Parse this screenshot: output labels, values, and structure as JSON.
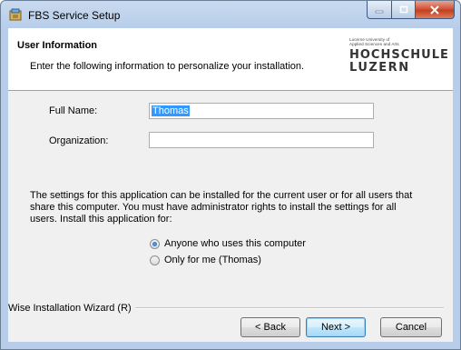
{
  "window": {
    "title": "FBS Service Setup",
    "icon": "installer-icon"
  },
  "caption_buttons": {
    "minimize": "–",
    "maximize": "□",
    "close": "✕"
  },
  "header": {
    "title": "User Information",
    "subtitle": "Enter the following information to personalize your installation.",
    "logo": {
      "small_line1": "Lucerne University of",
      "small_line2": "Applied Sciences and Arts",
      "line1": "HOCHSCHULE",
      "line2": "LUZERN"
    }
  },
  "form": {
    "full_name_label": "Full Name:",
    "full_name_value": "Thomas",
    "organization_label": "Organization:",
    "organization_value": ""
  },
  "info_text": "The settings for this application can be installed for the current user or for all users that share this computer. You must have administrator rights to install the settings for all users. Install this application for:",
  "install_for": {
    "options": [
      "Anyone who uses this computer",
      "Only for me (Thomas)"
    ],
    "selected": "Anyone who uses this computer"
  },
  "footer": {
    "brand": "Wise Installation Wizard (R)",
    "back_label": "< Back",
    "next_label": "Next >",
    "cancel_label": "Cancel"
  }
}
